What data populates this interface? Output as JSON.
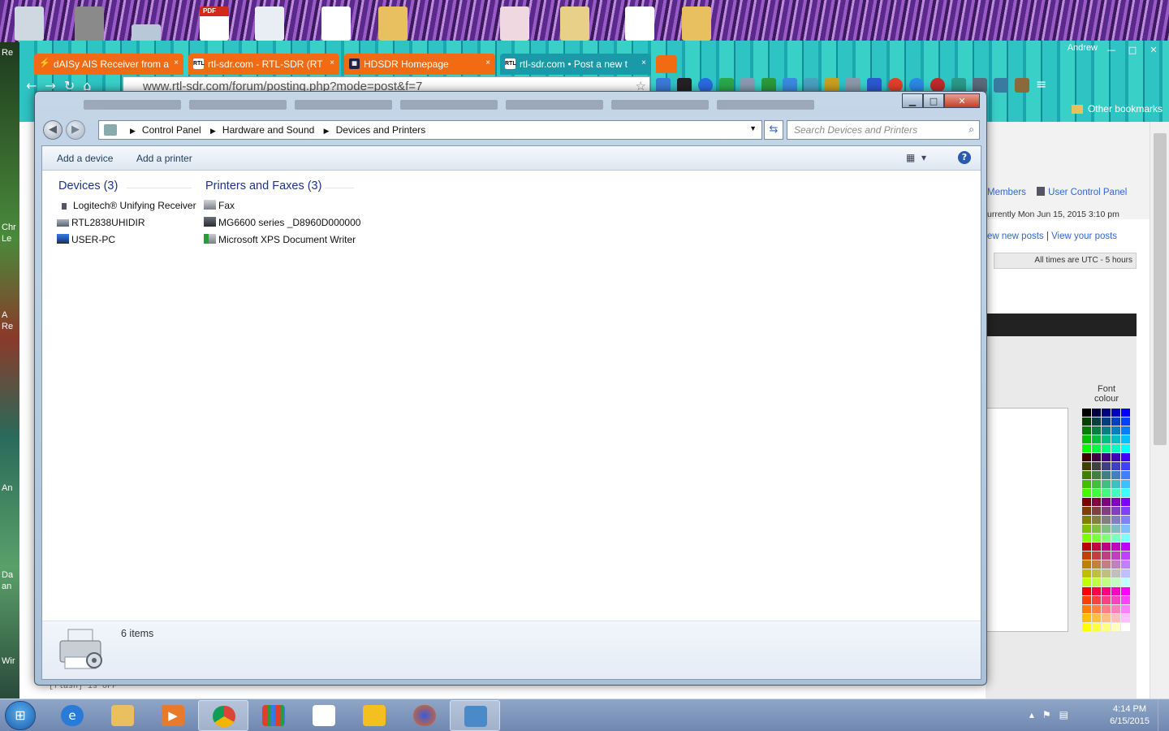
{
  "desktop": {
    "left_labels": [
      "Re",
      "Chr",
      "Le",
      "A",
      "Re",
      "An",
      "Da",
      "an",
      "Wir"
    ],
    "pdf_label": "PDF"
  },
  "chrome": {
    "account": "Andrew",
    "tabs": [
      {
        "label": "dAISy AIS Receiver from a",
        "icon_text": "⚡",
        "close": "×"
      },
      {
        "label": "rtl-sdr.com - RTL-SDR (RT",
        "icon_text": "RTL",
        "close": "×"
      },
      {
        "label": "HDSDR Homepage",
        "icon_text": "▦",
        "close": "×"
      },
      {
        "label": "rtl-sdr.com • Post a new t",
        "icon_text": "RTL",
        "close": "×"
      }
    ],
    "url": "www.rtl-sdr.com/forum/posting.php?mode=post&f=7",
    "other_bookmarks": "Other bookmarks",
    "window_controls": {
      "minimize": "—",
      "maximize": "□",
      "close": "✕"
    }
  },
  "forum": {
    "members": "Members",
    "user_control_panel": "User Control Panel",
    "current_time": "urrently Mon Jun 15, 2015 3:10 pm",
    "view_new_posts": "ew new posts",
    "separator": "|",
    "view_your_posts": "View your posts",
    "timezone": "All times are UTC - 5 hours",
    "font_colour": "Font colour",
    "flash_note": "[flash] is OFF"
  },
  "explorer": {
    "breadcrumb": [
      "Control Panel",
      "Hardware and Sound",
      "Devices and Printers"
    ],
    "search_placeholder": "Search Devices and Printers",
    "commands": {
      "add_device": "Add a device",
      "add_printer": "Add a printer"
    },
    "help_label": "?",
    "groups": [
      {
        "title": "Devices (3)",
        "items": [
          "Logitech® Unifying Receiver",
          "RTL2838UHIDIR",
          "USER-PC"
        ]
      },
      {
        "title": "Printers and Faxes (3)",
        "items": [
          "Fax",
          "MG6600 series _D8960D000000",
          "Microsoft XPS Document Writer"
        ]
      }
    ],
    "status": "6 items"
  },
  "taskbar": {
    "time": "4:14 PM",
    "date": "6/15/2015"
  },
  "colors": {
    "chrome_theme": "#1aa7b0",
    "tab_orange": "#f26a12",
    "group_title": "#1e3287",
    "taskbar": "#7088b0"
  }
}
